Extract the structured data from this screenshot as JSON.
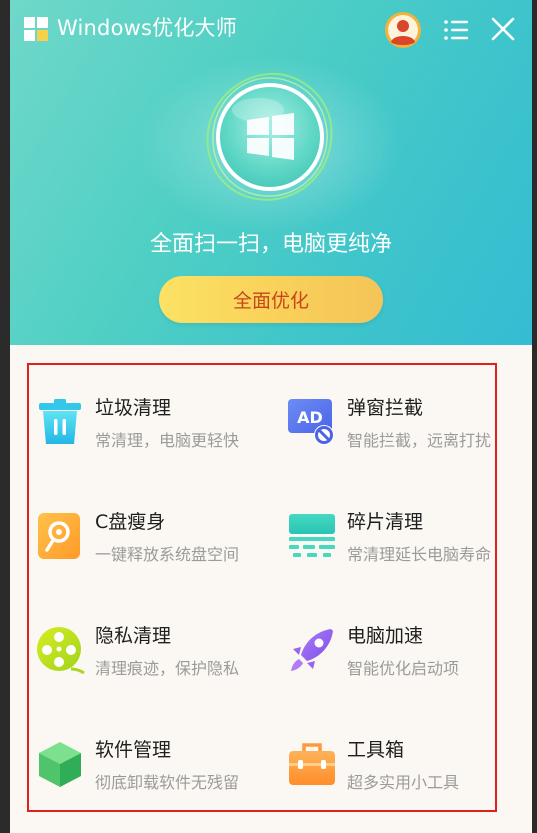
{
  "app": {
    "title": "Windows优化大师"
  },
  "hero": {
    "slogan": "全面扫一扫，电脑更纯净",
    "optimize_button": "全面优化"
  },
  "tools": [
    {
      "name": "垃圾清理",
      "desc": "常清理，电脑更轻快",
      "icon": "trash-icon"
    },
    {
      "name": "弹窗拦截",
      "desc": "智能拦截，远离打扰",
      "icon": "ad-block-icon"
    },
    {
      "name": "C盘瘦身",
      "desc": "一键释放系统盘空间",
      "icon": "c-drive-slim-icon"
    },
    {
      "name": "碎片清理",
      "desc": "常清理延长电脑寿命",
      "icon": "fragment-clean-icon"
    },
    {
      "name": "隐私清理",
      "desc": "清理痕迹，保护隐私",
      "icon": "privacy-clean-icon"
    },
    {
      "name": "电脑加速",
      "desc": "智能优化启动项",
      "icon": "rocket-icon"
    },
    {
      "name": "软件管理",
      "desc": "彻底卸载软件无残留",
      "icon": "software-cube-icon"
    },
    {
      "name": "工具箱",
      "desc": "超多实用小工具",
      "icon": "toolbox-icon"
    }
  ],
  "icons_text": {
    "ad_label": "AD"
  },
  "colors": {
    "hero_gradient_start": "#6fd8c9",
    "hero_gradient_end": "#36bcd3",
    "button_text": "#c8461a",
    "button_yellow": "#f9d25a",
    "highlight_border": "#e0201f",
    "panel_bg": "#fbf8f3"
  }
}
